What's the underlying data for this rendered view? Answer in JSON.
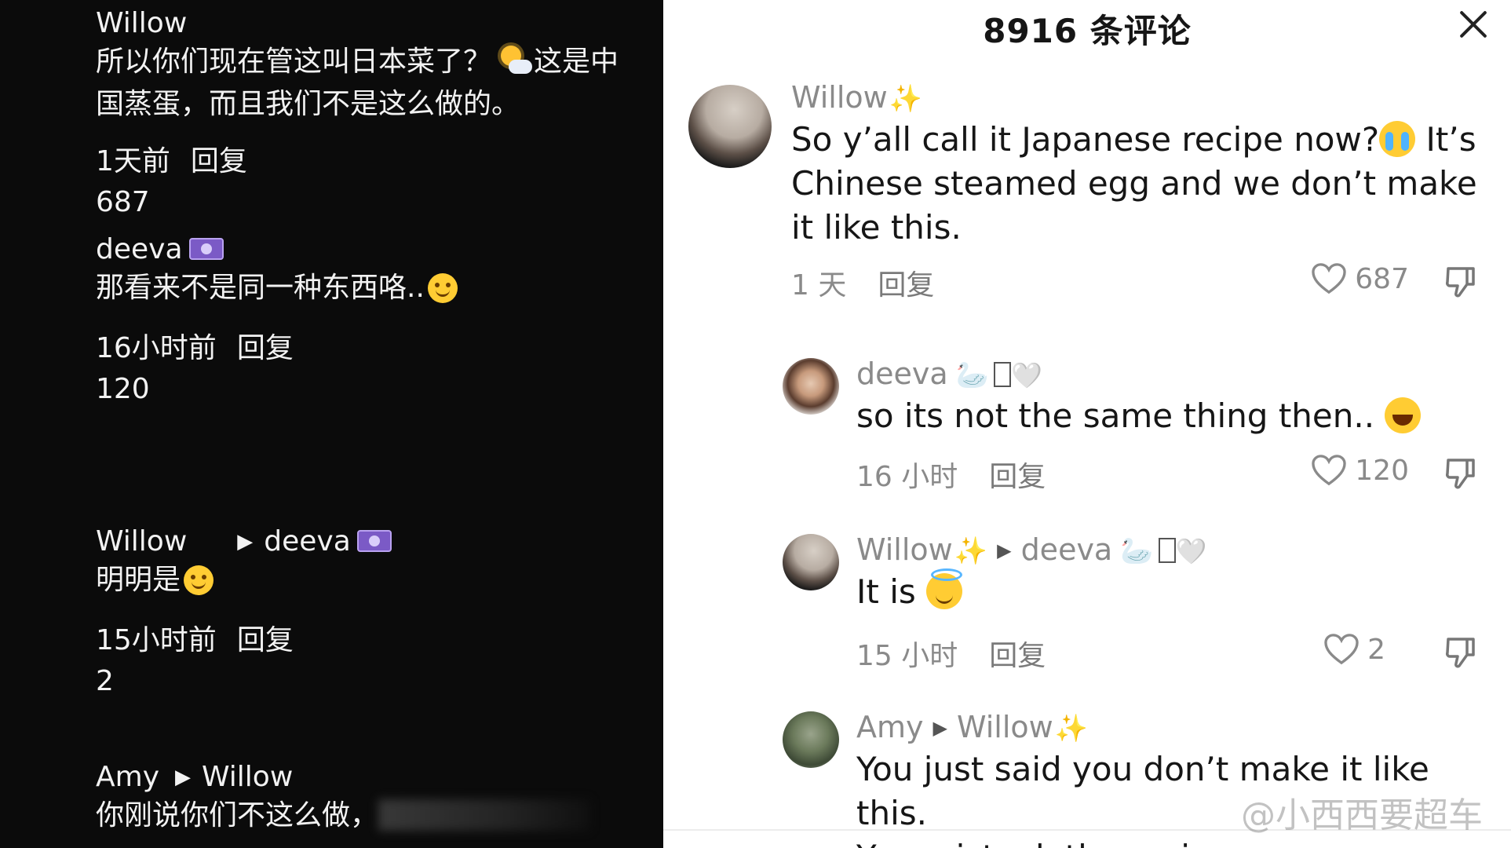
{
  "left_panel": {
    "comments": [
      {
        "name": "Willow",
        "text_line1": "所以你们现在管这叫日本菜了？",
        "text_line1b": "这是中",
        "text_line2": "国蒸蛋，而且我们不是这么做的。",
        "time": "1天前",
        "reply": "回复",
        "likes": "687"
      },
      {
        "name": "deeva",
        "text": "那看来不是同一种东西咯..",
        "time": "16小时前",
        "reply": "回复",
        "likes": "120"
      },
      {
        "name": "Willow",
        "reply_to": "deeva",
        "text": "明明是",
        "time": "15小时前",
        "reply": "回复",
        "likes": "2"
      },
      {
        "name": "Amy",
        "reply_to": "Willow",
        "text": "你刚说你们不这么做，"
      }
    ]
  },
  "sheet": {
    "title": "8916 条评论",
    "close_icon": "close-icon",
    "comments": [
      {
        "name": "Willow",
        "text_a": "So y’all call it Japanese recipe now?",
        "text_b": " It’s Chinese steamed egg and we don’t make it like this.",
        "time": "1 天",
        "reply": "回复",
        "likes": "687"
      },
      {
        "name": "deeva",
        "text": "so its not the same thing then.. ",
        "time": "16 小时",
        "reply": "回复",
        "likes": "120"
      },
      {
        "name": "Willow",
        "reply_to": "deeva",
        "text": "It is ",
        "time": "15 小时",
        "reply": "回复",
        "likes": "2"
      },
      {
        "name": "Amy",
        "reply_to": "Willow",
        "text_line1": "You just said you don’t make it like this.",
        "text_line2": "You mistook the reci"
      }
    ]
  },
  "watermark": "@小西西要超车",
  "colors": {
    "left_bg": "#0b0b0b",
    "left_text": "#f2f2f2",
    "sheet_bg": "#ffffff",
    "meta_gray": "#8a8a8a",
    "sparkle": "#f6c72d"
  }
}
